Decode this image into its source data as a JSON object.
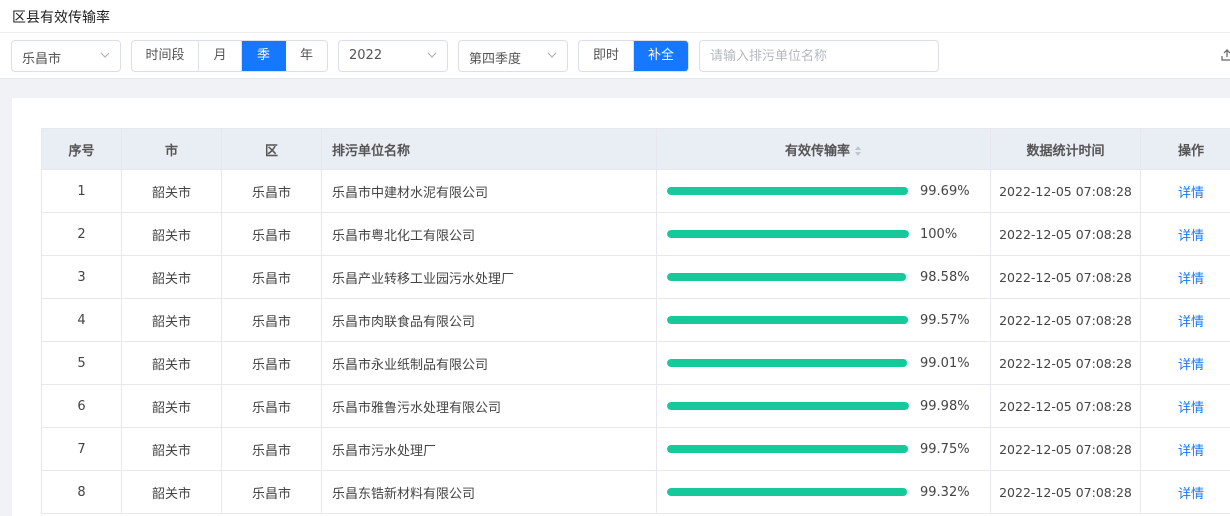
{
  "title": "区县有效传输率",
  "filters": {
    "city": "乐昌市",
    "period_buttons": [
      {
        "label": "时间段",
        "active": false
      },
      {
        "label": "月",
        "active": false
      },
      {
        "label": "季",
        "active": true
      },
      {
        "label": "年",
        "active": false
      }
    ],
    "year": "2022",
    "quarter": "第四季度",
    "mode_buttons": [
      {
        "label": "即时",
        "active": false
      },
      {
        "label": "补全",
        "active": true
      }
    ],
    "search_placeholder": "请输入排污单位名称",
    "search_value": ""
  },
  "table": {
    "columns": {
      "index": "序号",
      "city": "市",
      "district": "区",
      "name": "排污单位名称",
      "rate": "有效传输率",
      "time": "数据统计时间",
      "action": "操作"
    },
    "rows": [
      {
        "index": "1",
        "city": "韶关市",
        "district": "乐昌市",
        "name": "乐昌市中建材水泥有限公司",
        "rate": "99.69%",
        "rate_value": 99.69,
        "time": "2022-12-05 07:08:28",
        "action": "详情"
      },
      {
        "index": "2",
        "city": "韶关市",
        "district": "乐昌市",
        "name": "乐昌市粤北化工有限公司",
        "rate": "100%",
        "rate_value": 100,
        "time": "2022-12-05 07:08:28",
        "action": "详情"
      },
      {
        "index": "3",
        "city": "韶关市",
        "district": "乐昌市",
        "name": "乐昌产业转移工业园污水处理厂",
        "rate": "98.58%",
        "rate_value": 98.58,
        "time": "2022-12-05 07:08:28",
        "action": "详情"
      },
      {
        "index": "4",
        "city": "韶关市",
        "district": "乐昌市",
        "name": "乐昌市肉联食品有限公司",
        "rate": "99.57%",
        "rate_value": 99.57,
        "time": "2022-12-05 07:08:28",
        "action": "详情"
      },
      {
        "index": "5",
        "city": "韶关市",
        "district": "乐昌市",
        "name": "乐昌市永业纸制品有限公司",
        "rate": "99.01%",
        "rate_value": 99.01,
        "time": "2022-12-05 07:08:28",
        "action": "详情"
      },
      {
        "index": "6",
        "city": "韶关市",
        "district": "乐昌市",
        "name": "乐昌市雅鲁污水处理有限公司",
        "rate": "99.98%",
        "rate_value": 99.98,
        "time": "2022-12-05 07:08:28",
        "action": "详情"
      },
      {
        "index": "7",
        "city": "韶关市",
        "district": "乐昌市",
        "name": "乐昌市污水处理厂",
        "rate": "99.75%",
        "rate_value": 99.75,
        "time": "2022-12-05 07:08:28",
        "action": "详情"
      },
      {
        "index": "8",
        "city": "韶关市",
        "district": "乐昌市",
        "name": "乐昌东锆新材料有限公司",
        "rate": "99.32%",
        "rate_value": 99.32,
        "time": "2022-12-05 07:08:28",
        "action": "详情"
      }
    ]
  },
  "colors": {
    "accent": "#1677ff",
    "progress": "#16c99a",
    "header_bg": "#e9edf4"
  }
}
